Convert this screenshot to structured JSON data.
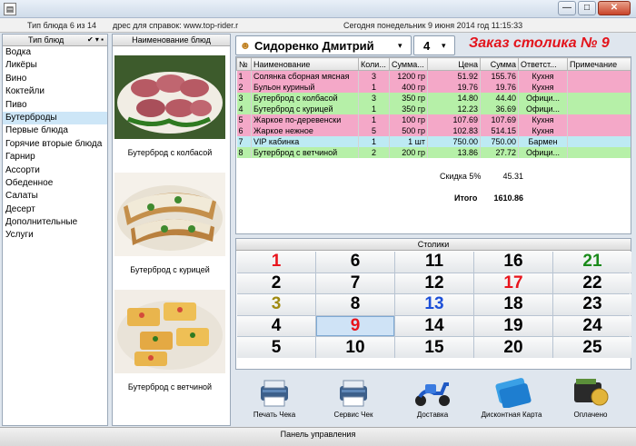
{
  "window": {
    "minimize": "—",
    "maximize": "□",
    "close": "✕"
  },
  "info": {
    "type_count": "Тип блюда 6 из 14",
    "help": "дрес для справок: www.top-rider.r",
    "date": "Сегодня  понедельник   9 июня 2014 год  11:15:33"
  },
  "categories": {
    "header": "Тип блюд",
    "items": [
      "Водка",
      "Ликёры",
      "Вино",
      "Коктейли",
      "Пиво",
      "Бутерброды",
      "Первые блюда",
      "Горячие вторые блюда",
      "Гарнир",
      "Ассорти",
      "Обеденное",
      "Салаты",
      "Десерт",
      "Дополнительные Услуги"
    ],
    "selected_index": 5
  },
  "dishes": {
    "header": "Наименование блюд",
    "items": [
      {
        "name": "Бутерброд с колбасой",
        "icon": "sausage-sandwich-photo"
      },
      {
        "name": "Бутерброд с курицей",
        "icon": "chicken-sandwich-photo"
      },
      {
        "name": "Бутерброд с ветчиной",
        "icon": "ham-sandwich-photo"
      }
    ]
  },
  "order": {
    "waiter": "Сидоренко Дмитрий",
    "table_no": "4",
    "title": "Заказ столика № 9",
    "columns": [
      "№",
      "Наименование",
      "Коли...",
      "Сумма...",
      "Цена",
      "Сумма",
      "Ответст...",
      "Примечание"
    ],
    "rows": [
      {
        "n": "1",
        "name": "Солянка сборная мясная",
        "qty": "3",
        "portion": "1200 гр",
        "price": "51.92",
        "sum": "155.76",
        "resp": "Кухня",
        "color": "#f4a8c8"
      },
      {
        "n": "2",
        "name": "Бульон куриный",
        "qty": "1",
        "portion": "400 гр",
        "price": "19.76",
        "sum": "19.76",
        "resp": "Кухня",
        "color": "#f4a8c8"
      },
      {
        "n": "3",
        "name": "Бутерброд с колбасой",
        "qty": "3",
        "portion": "350 гр",
        "price": "14.80",
        "sum": "44.40",
        "resp": "Офици...",
        "color": "#b6f0a8"
      },
      {
        "n": "4",
        "name": "Бутерброд с курицей",
        "qty": "1",
        "portion": "350 гр",
        "price": "12.23",
        "sum": "36.69",
        "resp": "Офици...",
        "color": "#b6f0a8"
      },
      {
        "n": "5",
        "name": "Жаркое по-деревенски",
        "qty": "1",
        "portion": "100 гр",
        "price": "107.69",
        "sum": "107.69",
        "resp": "Кухня",
        "color": "#f4a8c8"
      },
      {
        "n": "6",
        "name": "Жаркое нежное",
        "qty": "5",
        "portion": "500 гр",
        "price": "102.83",
        "sum": "514.15",
        "resp": "Кухня",
        "color": "#f4a8c8"
      },
      {
        "n": "7",
        "name": "VIP кабинка",
        "qty": "1",
        "portion": "1 шт",
        "price": "750.00",
        "sum": "750.00",
        "resp": "Бармен",
        "color": "#bdeaf3"
      },
      {
        "n": "8",
        "name": "Бутерброд с ветчиной",
        "qty": "2",
        "portion": "200 гр",
        "price": "13.86",
        "sum": "27.72",
        "resp": "Офици...",
        "color": "#b6f0a8"
      }
    ],
    "discount_label": "Скидка  5%",
    "discount_value": "45.31",
    "total_label": "Итого",
    "total_value": "1610.86"
  },
  "tables": {
    "header": "Столики",
    "numbers": [
      1,
      6,
      11,
      16,
      21,
      2,
      7,
      12,
      17,
      22,
      3,
      8,
      13,
      18,
      23,
      4,
      9,
      14,
      19,
      24,
      5,
      10,
      15,
      20,
      25
    ],
    "colors": {
      "1": "#e8141c",
      "21": "#1a8a1a",
      "17": "#e8141c",
      "3": "#a08a10",
      "13": "#1c4fd8",
      "9": "#e8141c"
    },
    "selected": 9
  },
  "actions": [
    {
      "label": "Печать Чека",
      "icon": "printer-icon"
    },
    {
      "label": "Сервис Чек",
      "icon": "printer-icon"
    },
    {
      "label": "Доставка",
      "icon": "scooter-icon"
    },
    {
      "label": "Дисконтная Карта",
      "icon": "discount-card-icon"
    },
    {
      "label": "Оплачено",
      "icon": "wallet-coin-icon"
    }
  ],
  "status": "Панель управления"
}
